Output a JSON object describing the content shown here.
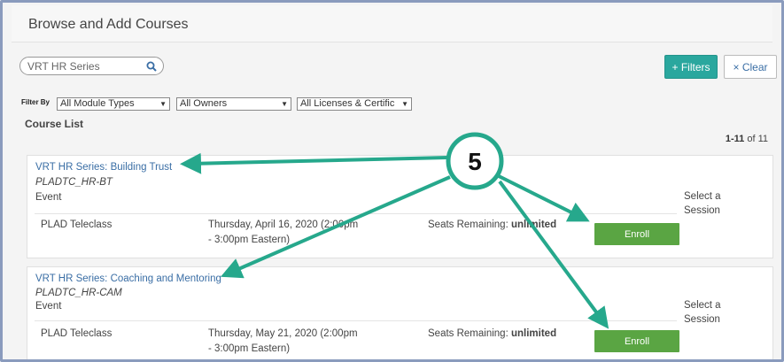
{
  "header": {
    "title": "Browse and Add Courses"
  },
  "search": {
    "value": "VRT HR Series"
  },
  "buttons": {
    "filters": "+ Filters",
    "clear": "× Clear"
  },
  "filter": {
    "label": "Filter By",
    "module_types": "All Module Types",
    "owners": "All Owners",
    "licenses": "All Licenses & Certific"
  },
  "list": {
    "title": "Course List",
    "range": "1-11",
    "of_label": "of 11"
  },
  "courses": [
    {
      "title": "VRT HR Series: Building Trust",
      "code": "PLADTC_HR-BT",
      "type": "Event",
      "location": "PLAD Teleclass",
      "date_line1": "Thursday, April 16, 2020 (2:00pm",
      "date_line2": "- 3:00pm Eastern)",
      "seats_label": "Seats Remaining:",
      "seats_value": "unlimited",
      "select_session": "Select a Session",
      "enroll": "Enroll"
    },
    {
      "title": "VRT HR Series: Coaching and Mentoring",
      "code": "PLADTC_HR-CAM",
      "type": "Event",
      "location": "PLAD Teleclass",
      "date_line1": "Thursday, May 21, 2020 (2:00pm",
      "date_line2": "- 3:00pm Eastern)",
      "seats_label": "Seats Remaining:",
      "seats_value": "unlimited",
      "select_session": "Select a Session",
      "enroll": "Enroll"
    }
  ],
  "annotation": {
    "label": "5",
    "color": "#26a88c"
  },
  "colors": {
    "accent": "#2aa79e",
    "enroll": "#5aa543",
    "link": "#3a6ea5"
  },
  "icons": {
    "search": "search-icon"
  }
}
